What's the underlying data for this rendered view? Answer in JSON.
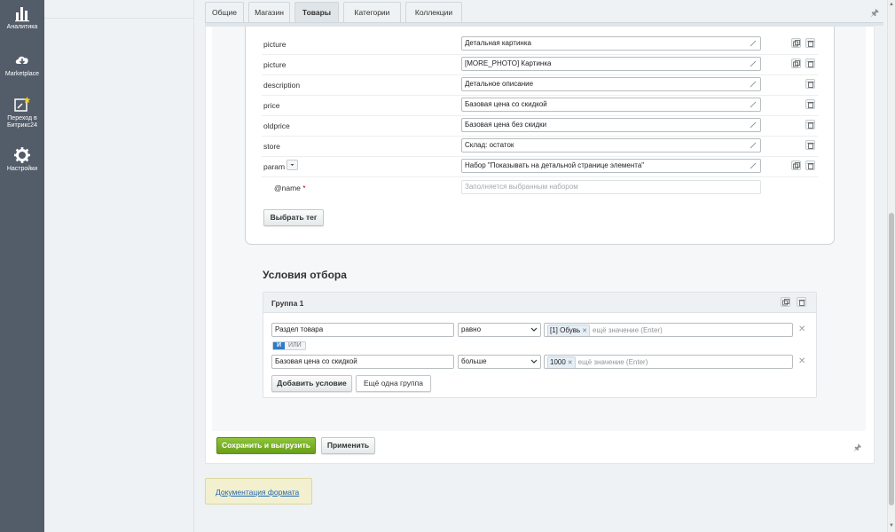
{
  "left_nav": {
    "items": [
      {
        "label": "Аналитика",
        "icon": "analytics-icon"
      },
      {
        "label": "Marketplace",
        "icon": "cloud-download-icon"
      },
      {
        "label": "Переход в Битрикс24",
        "icon": "bitrix24-star-icon"
      },
      {
        "label": "Настройки",
        "icon": "gear-icon"
      }
    ]
  },
  "tabs": [
    {
      "label": "Общие"
    },
    {
      "label": "Магазин"
    },
    {
      "label": "Товары",
      "active": true
    },
    {
      "label": "Категории"
    },
    {
      "label": "Коллекции"
    }
  ],
  "fields": [
    {
      "name": "picture",
      "value": "Детальная картинка",
      "copy": true
    },
    {
      "name": "picture",
      "value": "[MORE_PHOTO] Картинка",
      "copy": true
    },
    {
      "name": "description",
      "value": "Детальное описание",
      "copy": false
    },
    {
      "name": "price",
      "value": "Базовая цена со скидкой",
      "copy": false
    },
    {
      "name": "oldprice",
      "value": "Базовая цена без скидки",
      "copy": false
    },
    {
      "name": "store",
      "value": "Склад: остаток",
      "copy": false
    },
    {
      "name": "param",
      "value": "Набор \"Показывать на детальной странице элемента\"",
      "copy": true
    },
    {
      "name": "@name",
      "placeholder": "Заполняется выбранным набором",
      "required": "*"
    }
  ],
  "select_tag_button": "Выбрать тег",
  "conditions": {
    "title": "Условия отбора",
    "group_title": "Группа 1",
    "rows": [
      {
        "field": "Раздел товара",
        "operator": "равно",
        "tag": "[1] Обувь",
        "placeholder": "ещё значение (Enter)"
      },
      {
        "field": "Базовая цена со скидкой",
        "operator": "больше",
        "tag": "1000",
        "placeholder": "ещё значение (Enter)"
      }
    ],
    "logic_and": "И",
    "logic_or": "ИЛИ",
    "add_condition_button": "Добавить условие",
    "add_group_button": "Ещё одна группа"
  },
  "footer": {
    "save_button": "Сохранить и выгрузить",
    "apply_button": "Применить"
  },
  "doc_link": "Документация формата",
  "colors": {
    "left_nav_bg": "#535c69",
    "primary_green": "#7bb32a",
    "and_blue": "#2f7bc5",
    "doc_bg": "#f3f0cf"
  }
}
